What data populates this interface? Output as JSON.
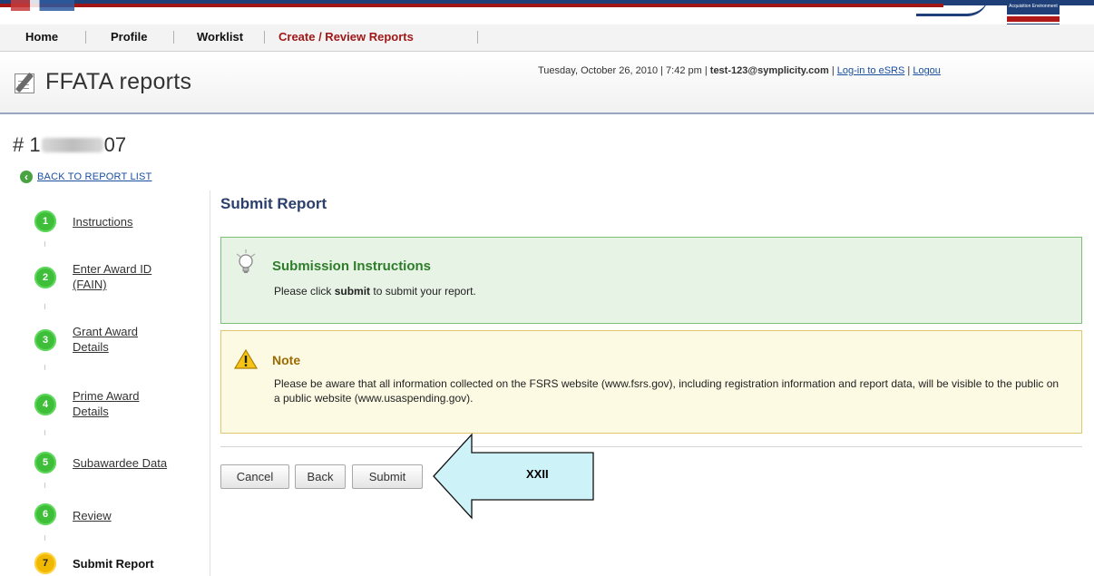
{
  "nav": {
    "items": [
      "Home",
      "Profile",
      "Worklist",
      "Create / Review Reports"
    ],
    "active_index": 3
  },
  "header": {
    "title": "FFATA reports",
    "datetime": "Tuesday, October 26, 2010 | 7:42 pm |",
    "user": "test-123@symplicity.com",
    "sep": "|",
    "esrs_link": "Log-in to eSRS",
    "logout_link": "Logou"
  },
  "report": {
    "id_prefix": "# 1",
    "id_suffix": "07",
    "back_link": "BACK TO REPORT LIST"
  },
  "steps": [
    {
      "number": "1",
      "label": "Instructions"
    },
    {
      "number": "2",
      "label": "Enter Award ID (FAIN)"
    },
    {
      "number": "3",
      "label": "Grant Award Details"
    },
    {
      "number": "4",
      "label": "Prime Award Details"
    },
    {
      "number": "5",
      "label": "Subawardee Data"
    },
    {
      "number": "6",
      "label": "Review"
    },
    {
      "number": "7",
      "label": "Submit Report"
    }
  ],
  "main": {
    "title": "Submit Report",
    "instructions": {
      "title": "Submission Instructions",
      "text_before": "Please click ",
      "text_bold": "submit",
      "text_after": " to submit your report."
    },
    "note": {
      "title": "Note",
      "text": "Please be aware that all information collected on the FSRS website (www.fsrs.gov), including registration information and report data, will be visible to the public on a public website (www.usaspending.gov)."
    },
    "buttons": {
      "cancel": "Cancel",
      "back": "Back",
      "submit": "Submit"
    },
    "callout_label": "XXII"
  },
  "colors": {
    "step_done": "#3fbe3a",
    "step_current": "#f0b800",
    "nav_active": "#a01818",
    "instructions_bg": "#e7f3e5",
    "note_bg": "#fdfae4",
    "callout_fill": "#cdf2f7"
  },
  "icons": {
    "page": "document-pencil-icon",
    "back": "back-arrow-icon",
    "instructions": "lightbulb-icon",
    "note": "warning-icon",
    "callout": "left-arrow-callout"
  }
}
